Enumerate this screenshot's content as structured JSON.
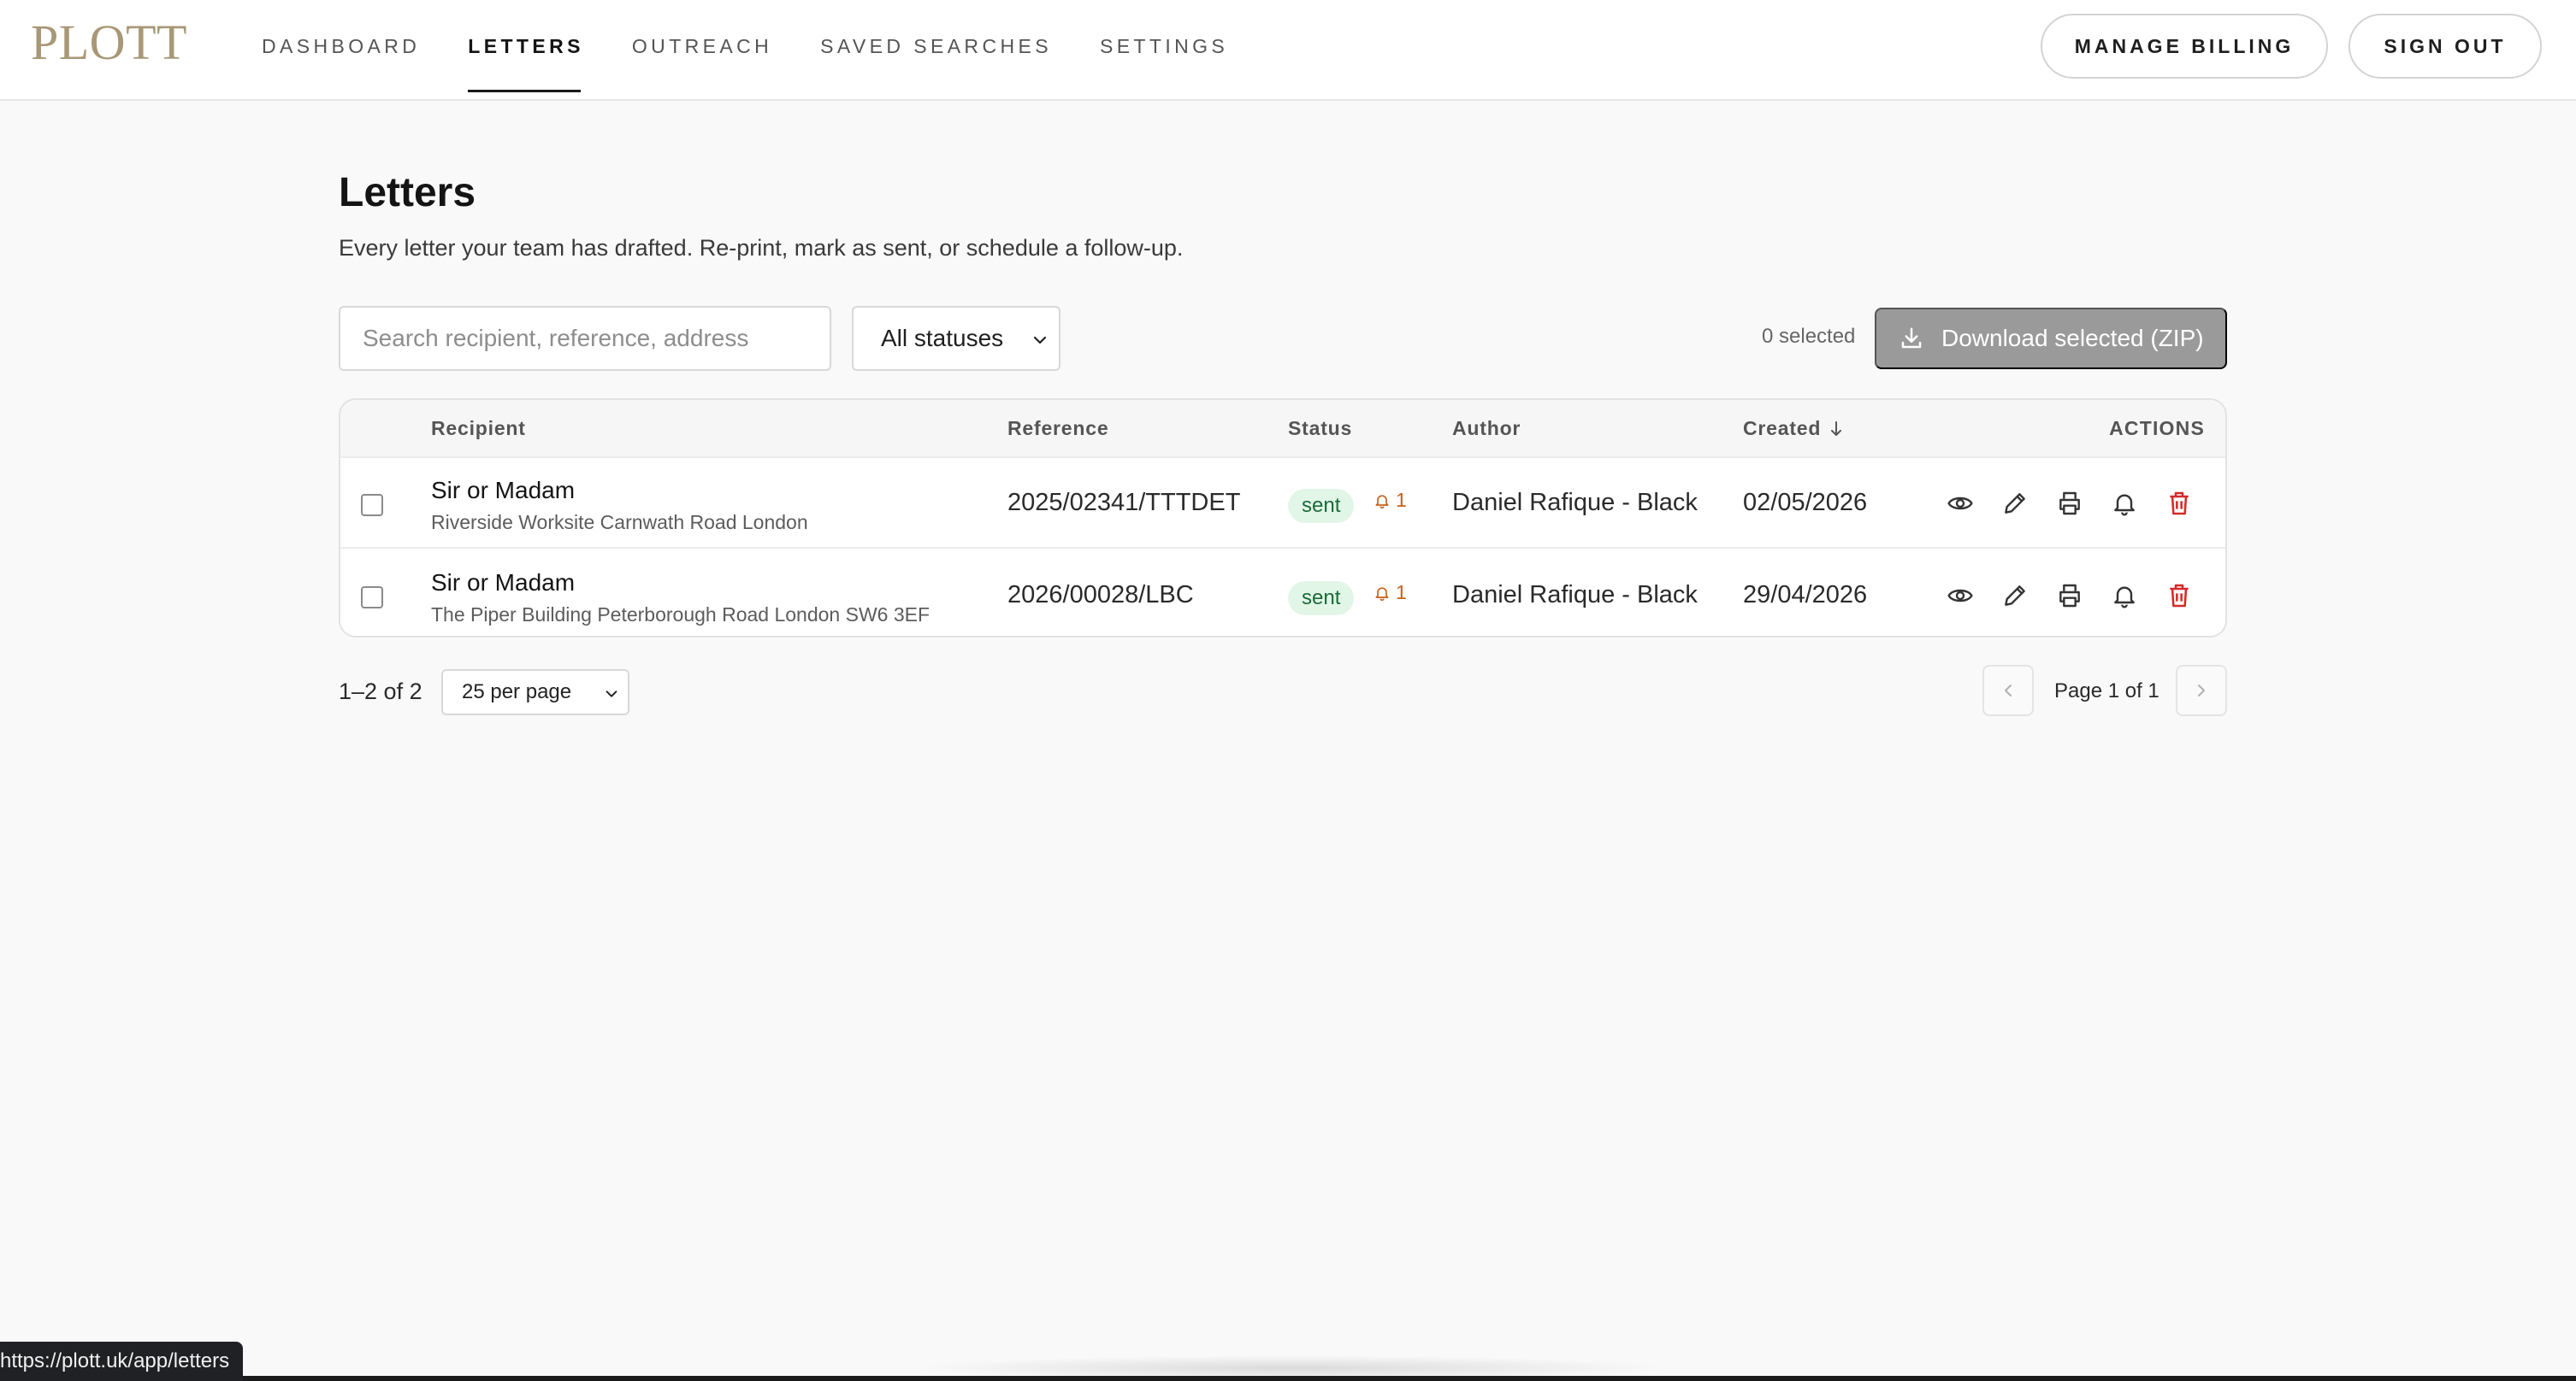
{
  "brand": {
    "logo": "PLOTT",
    "logo_color": "#a89877"
  },
  "nav": {
    "items": [
      {
        "label": "DASHBOARD",
        "active": false
      },
      {
        "label": "LETTERS",
        "active": true
      },
      {
        "label": "OUTREACH",
        "active": false
      },
      {
        "label": "SAVED SEARCHES",
        "active": false
      },
      {
        "label": "SETTINGS",
        "active": false
      }
    ]
  },
  "header_actions": {
    "billing_label": "MANAGE BILLING",
    "signout_label": "SIGN OUT"
  },
  "page": {
    "title": "Letters",
    "subtitle": "Every letter your team has drafted. Re-print, mark as sent, or schedule a follow-up."
  },
  "toolbar": {
    "search_placeholder": "Search recipient, reference, address",
    "search_value": "",
    "status_filter": "All statuses",
    "selected_count": "0 selected",
    "download_label": "Download selected (ZIP)"
  },
  "table": {
    "columns": {
      "recipient": "Recipient",
      "reference": "Reference",
      "status": "Status",
      "author": "Author",
      "created": "Created",
      "actions": "ACTIONS"
    },
    "sort": {
      "column": "created",
      "direction": "desc"
    },
    "rows": [
      {
        "selected": false,
        "recipient": "Sir or Madam",
        "address": "Riverside Worksite Carnwath Road London",
        "reference": "2025/02341/TTTDET",
        "status": "sent",
        "followups": "1",
        "author": "Daniel Rafique - Black",
        "created": "02/05/2026"
      },
      {
        "selected": false,
        "recipient": "Sir or Madam",
        "address": "The Piper Building Peterborough Road London SW6 3EF",
        "reference": "2026/00028/LBC",
        "status": "sent",
        "followups": "1",
        "author": "Daniel Rafique - Black",
        "created": "29/04/2026"
      }
    ],
    "row_actions": [
      "eye-icon",
      "pencil-icon",
      "printer-icon",
      "bell-icon",
      "trash-icon"
    ]
  },
  "pagination": {
    "range": "1–2 of 2",
    "per_page": "25 per page",
    "page_label": "Page 1 of 1"
  },
  "browser": {
    "status_url": "https://plott.uk/app/letters"
  },
  "colors": {
    "status_sent_bg": "#e2f6e8",
    "status_sent_text": "#1a6b37",
    "followup": "#c6621a",
    "delete": "#d42a2a",
    "download_disabled": "#9a9a9a"
  }
}
